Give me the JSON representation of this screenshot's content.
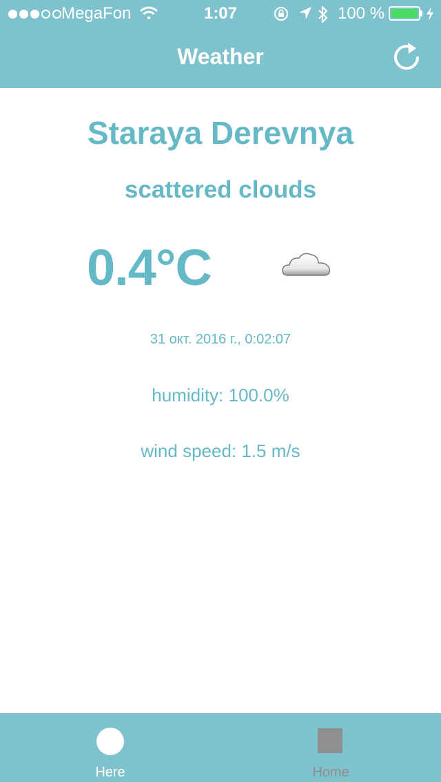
{
  "status_bar": {
    "signal_bars": 3,
    "signal_total": 5,
    "carrier": "MegaFon",
    "time": "1:07",
    "battery_text": "100 %",
    "battery_level": 1.0
  },
  "nav": {
    "title": "Weather"
  },
  "weather": {
    "city": "Staraya Derevnya",
    "description": "scattered clouds",
    "temperature": "0.4°C",
    "datetime": "31 окт. 2016 г., 0:02:07",
    "humidity": "humidity: 100.0%",
    "wind_speed": "wind speed: 1.5 m/s",
    "icon": "cloud-icon"
  },
  "tabs": [
    {
      "label": "Here",
      "selected": true
    },
    {
      "label": "Home",
      "selected": false
    }
  ],
  "colors": {
    "accent": "#7dc2cd",
    "text": "#65b8c6",
    "tab_inactive": "#8f8f8f",
    "battery": "#4cd964"
  }
}
